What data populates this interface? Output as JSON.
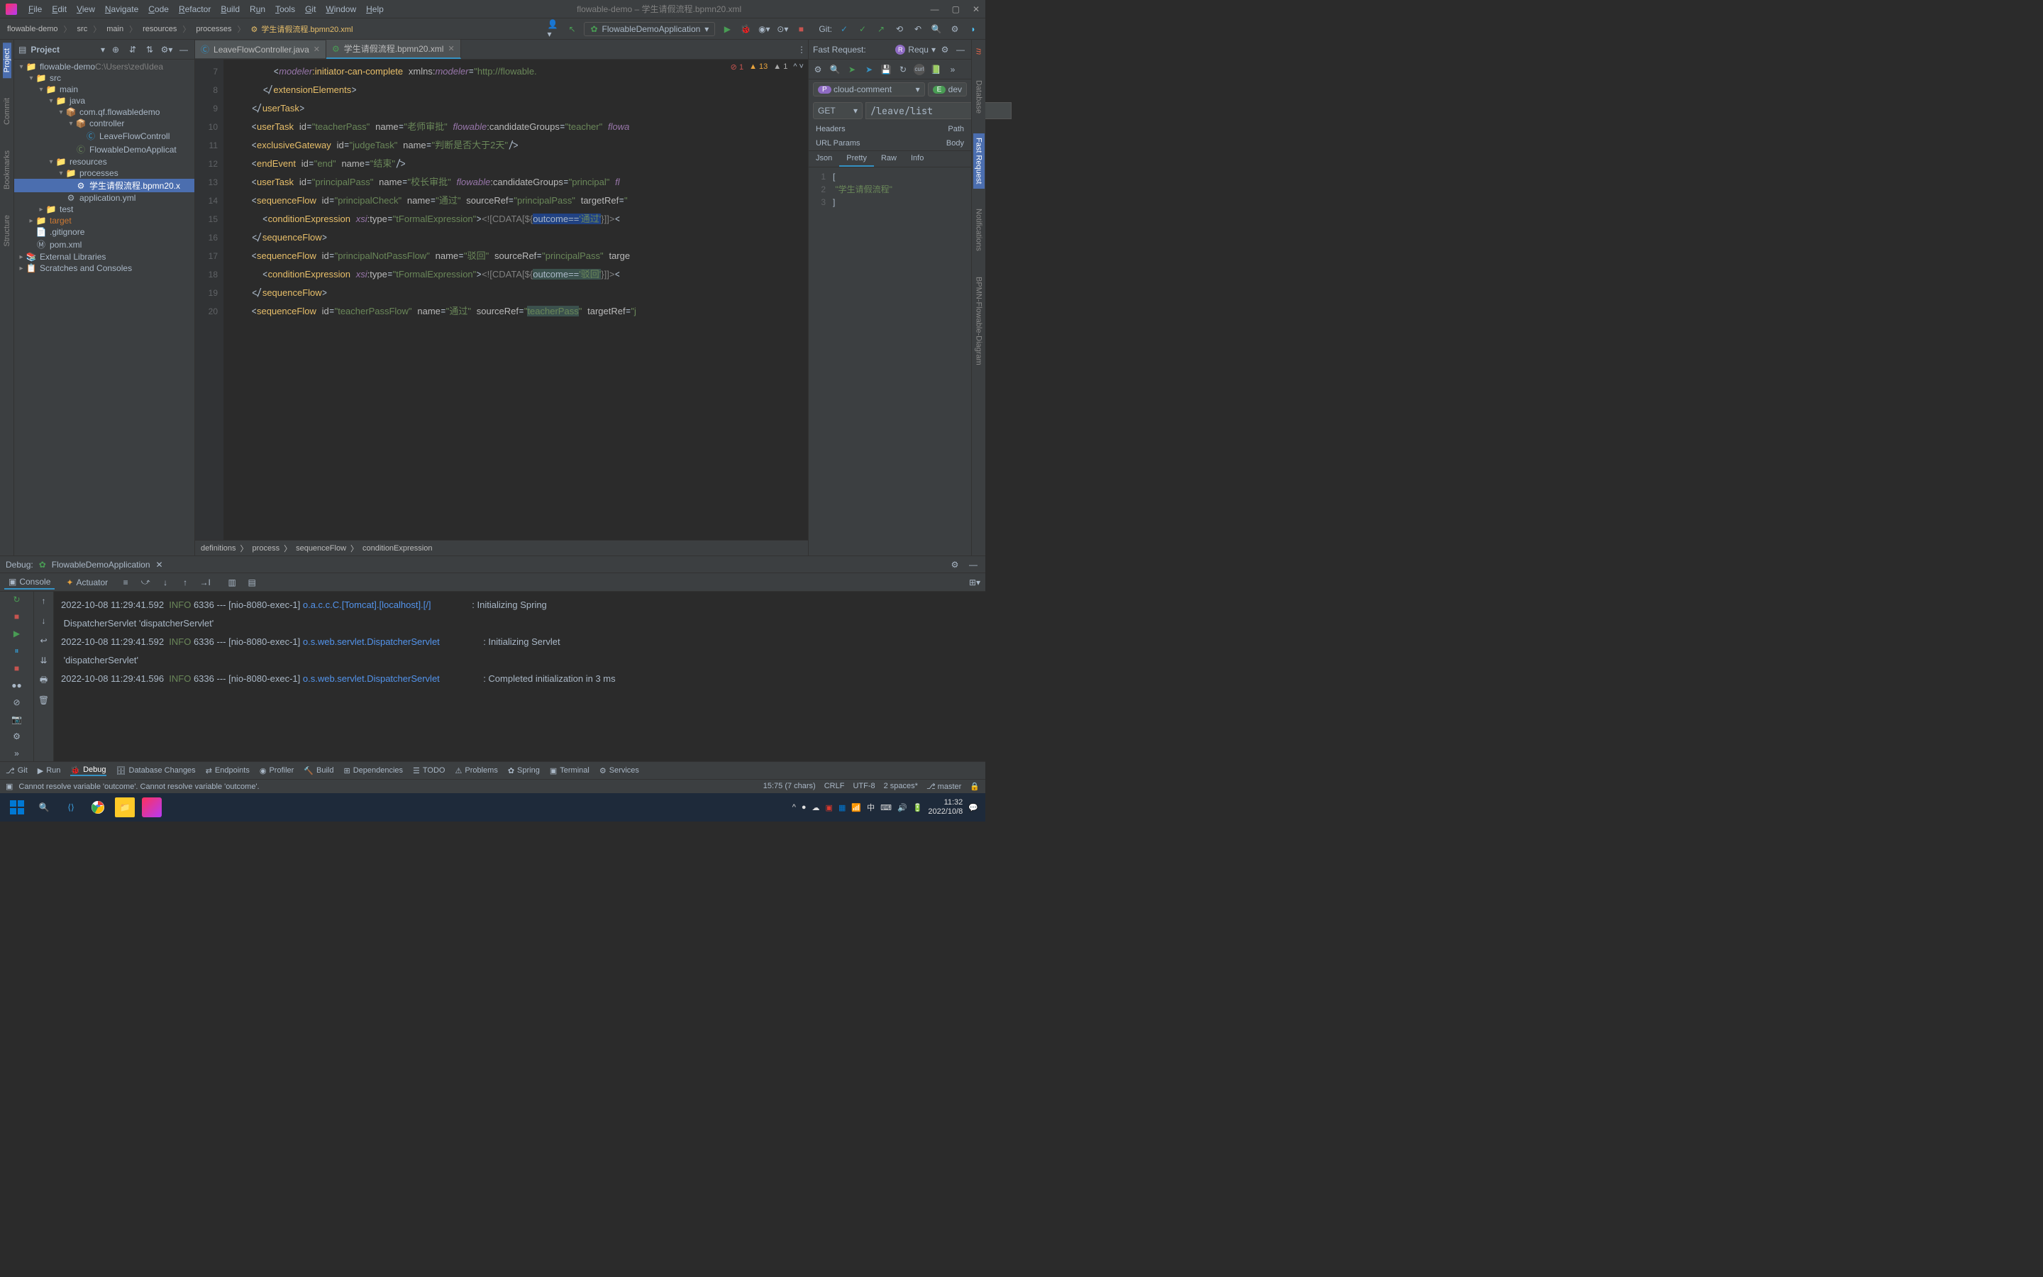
{
  "titlebar": {
    "menus": [
      "File",
      "Edit",
      "View",
      "Navigate",
      "Code",
      "Refactor",
      "Build",
      "Run",
      "Tools",
      "Git",
      "Window",
      "Help"
    ],
    "title": "flowable-demo – 学生请假流程.bpmn20.xml"
  },
  "breadcrumb": [
    "flowable-demo",
    "src",
    "main",
    "resources",
    "processes",
    "学生请假流程.bpmn20.xml"
  ],
  "runConfig": "FlowableDemoApplication",
  "gitLabel": "Git:",
  "projectPanel": {
    "title": "Project",
    "tree": [
      {
        "depth": 0,
        "arrow": "▾",
        "icon": "📁",
        "name": "flowable-demo",
        "suffix": " C:\\Users\\zed\\Idea"
      },
      {
        "depth": 1,
        "arrow": "▾",
        "icon": "📁",
        "name": "src"
      },
      {
        "depth": 2,
        "arrow": "▾",
        "icon": "📁",
        "name": "main"
      },
      {
        "depth": 3,
        "arrow": "▾",
        "icon": "📁",
        "name": "java"
      },
      {
        "depth": 4,
        "arrow": "▾",
        "icon": "📦",
        "name": "com.qf.flowabledemo"
      },
      {
        "depth": 5,
        "arrow": "▾",
        "icon": "📦",
        "name": "controller"
      },
      {
        "depth": 6,
        "arrow": "",
        "icon": "Ⓒ",
        "name": "LeaveFlowControll",
        "cls": "file-icon-blue"
      },
      {
        "depth": 5,
        "arrow": "",
        "icon": "Ⓒ",
        "name": "FlowableDemoApplicat",
        "cls": "file-icon-green"
      },
      {
        "depth": 3,
        "arrow": "▾",
        "icon": "📁",
        "name": "resources"
      },
      {
        "depth": 4,
        "arrow": "▾",
        "icon": "📁",
        "name": "processes"
      },
      {
        "depth": 5,
        "arrow": "",
        "icon": "⚙",
        "name": "学生请假流程.bpmn20.x",
        "selected": true
      },
      {
        "depth": 4,
        "arrow": "",
        "icon": "⚙",
        "name": "application.yml"
      },
      {
        "depth": 2,
        "arrow": "▸",
        "icon": "📁",
        "name": "test"
      },
      {
        "depth": 1,
        "arrow": "▸",
        "icon": "📁",
        "name": "target",
        "orange": true
      },
      {
        "depth": 1,
        "arrow": "",
        "icon": "📄",
        "name": ".gitignore"
      },
      {
        "depth": 1,
        "arrow": "",
        "icon": "Ⓜ",
        "name": "pom.xml"
      },
      {
        "depth": 0,
        "arrow": "▸",
        "icon": "📚",
        "name": "External Libraries"
      },
      {
        "depth": 0,
        "arrow": "▸",
        "icon": "📋",
        "name": "Scratches and Consoles"
      }
    ]
  },
  "editorTabs": [
    {
      "icon": "Ⓒ",
      "label": "LeaveFlowController.java",
      "active": false
    },
    {
      "icon": "⚙",
      "label": "学生请假流程.bpmn20.xml",
      "active": true
    }
  ],
  "indicators": {
    "errors": "1",
    "warnings": "13",
    "weak": "1"
  },
  "codeLines": [
    7,
    8,
    9,
    10,
    11,
    12,
    13,
    14,
    15,
    16,
    17,
    18,
    19,
    20
  ],
  "editorBreadcrumb": [
    "definitions",
    "process",
    "sequenceFlow",
    "conditionExpression"
  ],
  "fastRequest": {
    "title": "Fast Request:",
    "requestBtn": "Requ",
    "project": "cloud-comment",
    "env": "dev",
    "method": "GET",
    "url": "/leave/list",
    "tabs1": [
      "Headers",
      "Path"
    ],
    "tabs2": [
      "URL Params",
      "Body"
    ],
    "respTabs": [
      "Json",
      "Pretty",
      "Raw",
      "Info"
    ],
    "respActive": "Pretty",
    "jsonLines": [
      {
        "n": 1,
        "t": "["
      },
      {
        "n": 2,
        "t": "    \"学生请假流程\"",
        "str": true
      },
      {
        "n": 3,
        "t": "]"
      }
    ]
  },
  "debug": {
    "title": "Debug:",
    "config": "FlowableDemoApplication",
    "toolTabs": [
      {
        "label": "Console",
        "icon": "▣",
        "active": true
      },
      {
        "label": "Actuator",
        "icon": "✦"
      }
    ],
    "logs": [
      {
        "ts": "2022-10-08 11:29:41.592",
        "level": "INFO",
        "pid": "6336",
        "thread": "[nio-8080-exec-1]",
        "cls": "o.a.c.c.C.[Tomcat].[localhost].[/]",
        "msg": ": Initializing Spring",
        "cont": "DispatcherServlet 'dispatcherServlet'"
      },
      {
        "ts": "2022-10-08 11:29:41.592",
        "level": "INFO",
        "pid": "6336",
        "thread": "[nio-8080-exec-1]",
        "cls": "o.s.web.servlet.DispatcherServlet",
        "msg": ": Initializing Servlet",
        "cont": "'dispatcherServlet'"
      },
      {
        "ts": "2022-10-08 11:29:41.596",
        "level": "INFO",
        "pid": "6336",
        "thread": "[nio-8080-exec-1]",
        "cls": "o.s.web.servlet.DispatcherServlet",
        "msg": ": Completed initialization in 3 ms"
      }
    ]
  },
  "bottomTools": [
    {
      "icon": "⎇",
      "label": "Git"
    },
    {
      "icon": "▶",
      "label": "Run"
    },
    {
      "icon": "🐞",
      "label": "Debug",
      "active": true
    },
    {
      "icon": "🗄",
      "label": "Database Changes"
    },
    {
      "icon": "⇄",
      "label": "Endpoints"
    },
    {
      "icon": "◉",
      "label": "Profiler"
    },
    {
      "icon": "🔨",
      "label": "Build"
    },
    {
      "icon": "⊞",
      "label": "Dependencies"
    },
    {
      "icon": "☰",
      "label": "TODO"
    },
    {
      "icon": "⚠",
      "label": "Problems"
    },
    {
      "icon": "✿",
      "label": "Spring"
    },
    {
      "icon": "▣",
      "label": "Terminal"
    },
    {
      "icon": "⚙",
      "label": "Services"
    }
  ],
  "statusBar": {
    "message": "Cannot resolve variable 'outcome'. Cannot resolve variable 'outcome'.",
    "pos": "15:75 (7 chars)",
    "eol": "CRLF",
    "enc": "UTF-8",
    "indent": "2 spaces*",
    "branch": "master"
  },
  "leftStrip": [
    "Project",
    "Commit",
    "Bookmarks",
    "Structure"
  ],
  "rightStrip": [
    "Maven",
    "Database",
    "Fast Request",
    "Notifications"
  ],
  "taskbar": {
    "time": "11:32",
    "date": "2022/10/8"
  }
}
